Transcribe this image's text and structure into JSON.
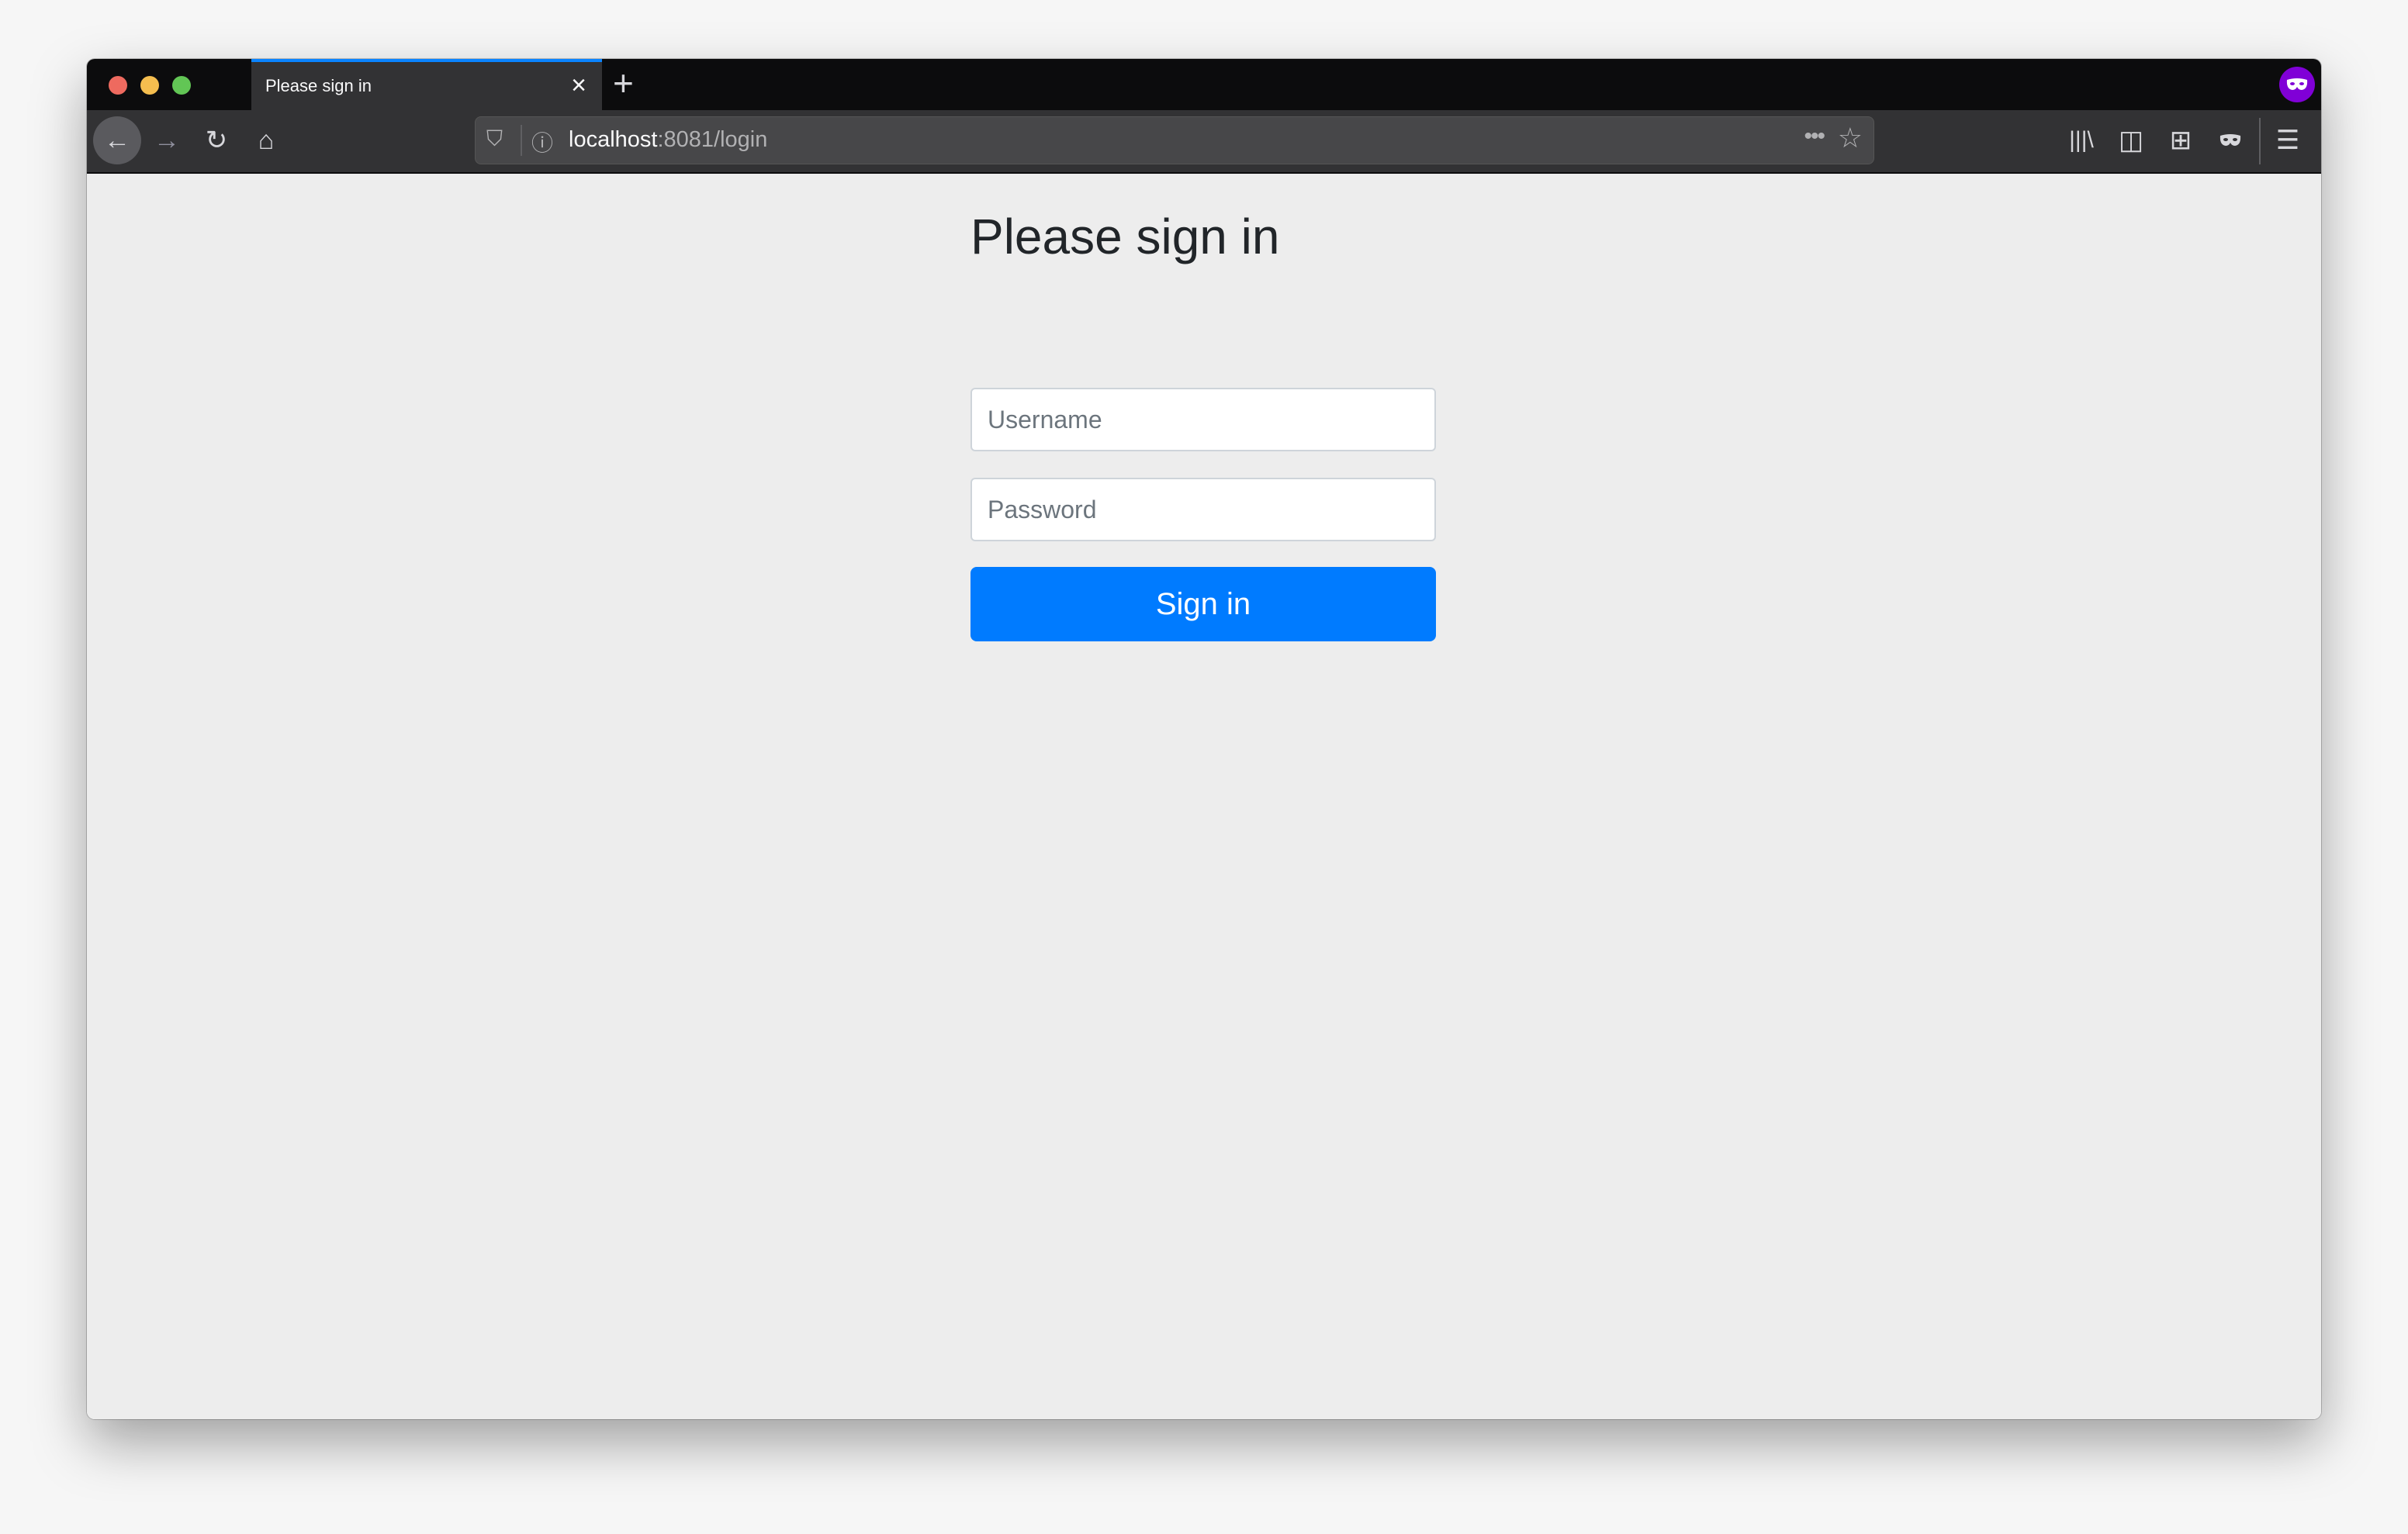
{
  "browser": {
    "tab_title": "Please sign in",
    "url_host": "localhost",
    "url_rest": ":8081/login",
    "accent_color": "#0a84ff",
    "private_color": "#8000d7",
    "icons": [
      "back-icon",
      "forward-icon",
      "reload-icon",
      "home-icon",
      "shield-icon",
      "info-icon",
      "more-icon",
      "star-icon",
      "library-icon",
      "sidebar-icon",
      "new-container-tab-icon",
      "private-mask-icon",
      "menu-icon"
    ]
  },
  "page": {
    "heading": "Please sign in",
    "username_placeholder": "Username",
    "password_placeholder": "Password",
    "submit_label": "Sign in",
    "button_color": "#007bff"
  }
}
